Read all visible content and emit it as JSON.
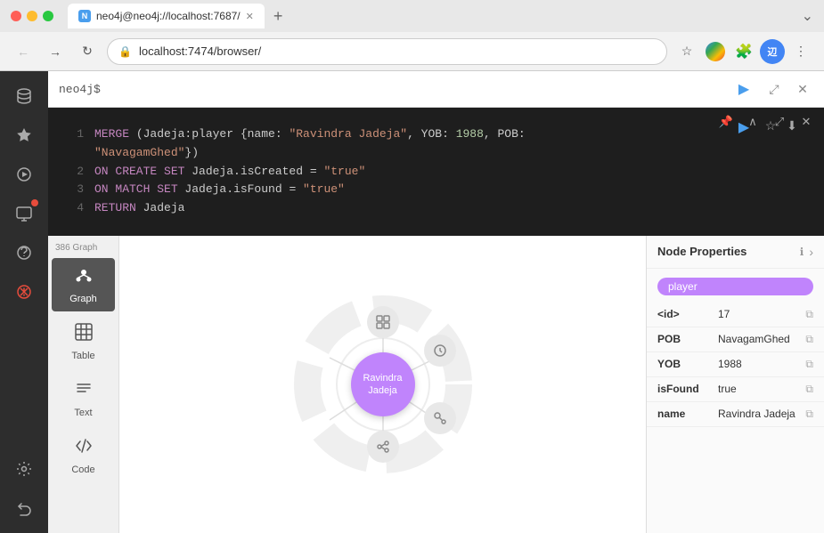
{
  "titlebar": {
    "tab_title": "neo4j@neo4j://localhost:7687/",
    "tab_new_label": "+",
    "tab_extras": "⌄"
  },
  "addressbar": {
    "url": "localhost:7474/browser/",
    "back_label": "←",
    "forward_label": "→",
    "refresh_label": "↻"
  },
  "cmd_bar": {
    "placeholder": "neo4j$",
    "run_label": "▶",
    "expand_label": "⤢",
    "close_label": "✕"
  },
  "sidebar": {
    "icons": [
      {
        "name": "database",
        "symbol": "🗄",
        "active": false
      },
      {
        "name": "star",
        "symbol": "★",
        "active": false
      },
      {
        "name": "play",
        "symbol": "▶",
        "active": false
      },
      {
        "name": "graph-circle",
        "symbol": "◎",
        "active": false,
        "has_badge": true
      },
      {
        "name": "question",
        "symbol": "?",
        "active": false
      },
      {
        "name": "alert",
        "symbol": "⊗",
        "active": false
      },
      {
        "name": "settings",
        "symbol": "⚙",
        "active": false
      },
      {
        "name": "undo",
        "symbol": "↺",
        "active": false
      }
    ]
  },
  "query": {
    "lines": [
      {
        "num": "1",
        "tokens": [
          {
            "type": "keyword",
            "text": "MERGE "
          },
          {
            "type": "plain",
            "text": "(Jadeja:player {name: "
          },
          {
            "type": "string",
            "text": "\"Ravindra Jadeja\""
          },
          {
            "type": "plain",
            "text": ", YOB: "
          },
          {
            "type": "number",
            "text": "1988"
          },
          {
            "type": "plain",
            "text": ", POB:"
          }
        ]
      },
      {
        "num": "",
        "tokens": [
          {
            "type": "string",
            "text": "\"NavagamGhed\""
          },
          {
            "type": "plain",
            "text": "})"
          }
        ]
      },
      {
        "num": "2",
        "tokens": [
          {
            "type": "keyword",
            "text": "ON CREATE SET "
          },
          {
            "type": "plain",
            "text": "Jadeja.isCreated = "
          },
          {
            "type": "string",
            "text": "\"true\""
          }
        ]
      },
      {
        "num": "3",
        "tokens": [
          {
            "type": "keyword",
            "text": "ON MATCH SET "
          },
          {
            "type": "plain",
            "text": "Jadeja.isFound = "
          },
          {
            "type": "string",
            "text": "\"true\""
          }
        ]
      },
      {
        "num": "4",
        "tokens": [
          {
            "type": "keyword",
            "text": "RETURN "
          },
          {
            "type": "plain",
            "text": "Jadeja"
          }
        ]
      }
    ]
  },
  "view_modes": [
    {
      "id": "graph",
      "label": "Graph",
      "symbol": "⬡",
      "active": true
    },
    {
      "id": "table",
      "label": "Table",
      "symbol": "⊞",
      "active": false
    },
    {
      "id": "text",
      "label": "Text",
      "symbol": "T",
      "active": false
    },
    {
      "id": "code",
      "label": "Code",
      "symbol": "{ }",
      "active": false
    }
  ],
  "result_count": "386 Graph",
  "node": {
    "label": "player",
    "main_text": "Ravindra\nJadeja"
  },
  "node_properties": {
    "title": "Node Properties",
    "info_symbol": "ℹ",
    "expand_symbol": "›",
    "label": "player",
    "props": [
      {
        "key": "<id>",
        "value": "17"
      },
      {
        "key": "POB",
        "value": "NavagamGhed"
      },
      {
        "key": "YOB",
        "value": "1988"
      },
      {
        "key": "isFound",
        "value": "true"
      },
      {
        "key": "name",
        "value": "Ravindra Jadeja"
      }
    ]
  },
  "colors": {
    "node_purple": "#c084fc",
    "keyword_purple": "#c586c0",
    "string_orange": "#ce9178",
    "number_green": "#b5cea8",
    "code_bg": "#1e1e1e",
    "active_view_bg": "#555555"
  }
}
